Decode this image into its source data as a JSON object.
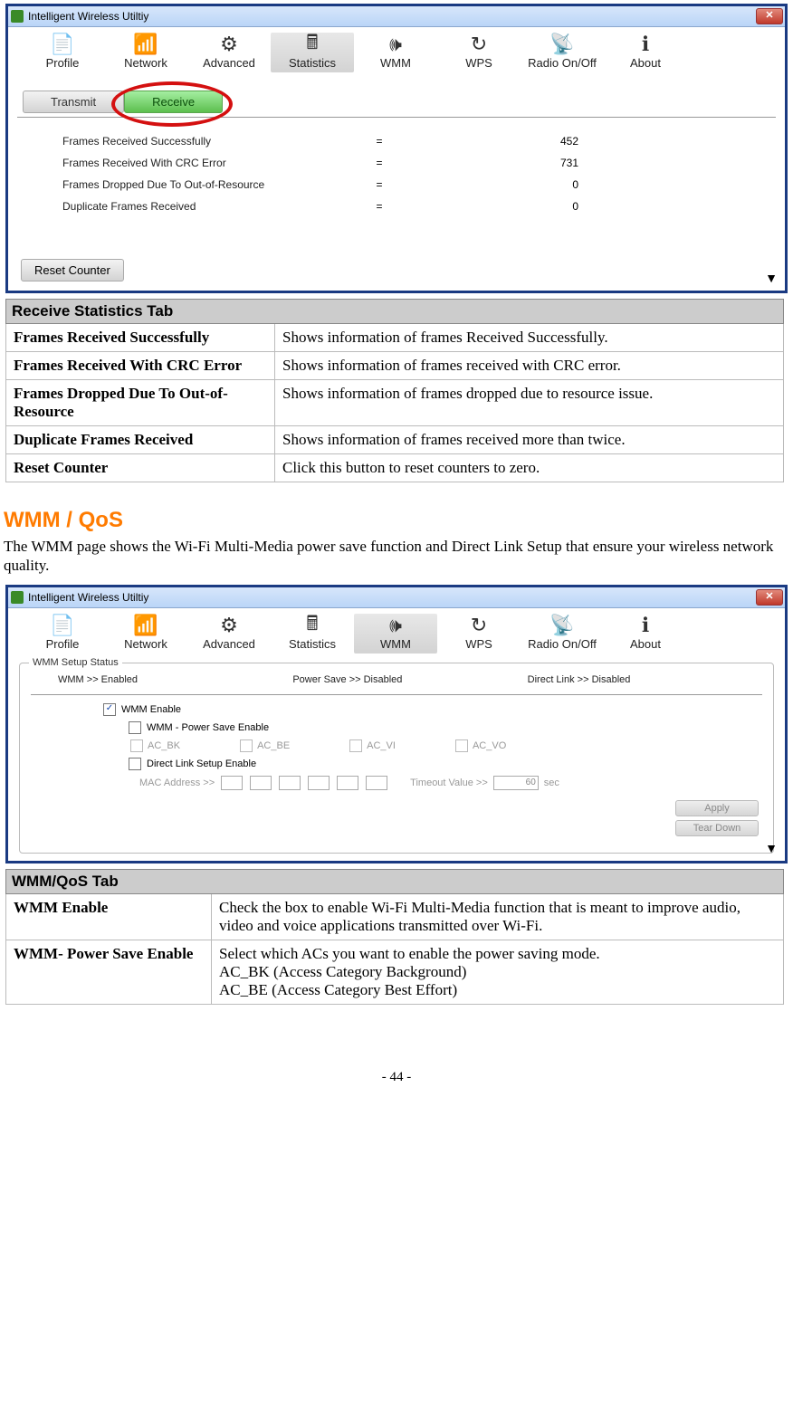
{
  "window_title": "Intelligent Wireless Utiltiy",
  "toolbar": [
    "Profile",
    "Network",
    "Advanced",
    "Statistics",
    "WMM",
    "WPS",
    "Radio On/Off",
    "About"
  ],
  "toolbar_icons": [
    "profile-icon",
    "network-icon",
    "advanced-icon",
    "statistics-icon",
    "wmm-icon",
    "wps-icon",
    "radio-icon",
    "about-icon"
  ],
  "toolbar_glyphs": [
    "📄",
    "📶",
    "⚙",
    "🖩",
    "🕪",
    "↻",
    "📡",
    "ℹ"
  ],
  "win1": {
    "active_tool": 3,
    "tabs": {
      "transmit": "Transmit",
      "receive": "Receive",
      "active": "receive"
    },
    "stats": [
      {
        "label": "Frames Received Successfully",
        "value": "452"
      },
      {
        "label": "Frames Received With CRC Error",
        "value": "731"
      },
      {
        "label": "Frames Dropped Due To Out-of-Resource",
        "value": "0"
      },
      {
        "label": "Duplicate Frames Received",
        "value": "0"
      }
    ],
    "reset_label": "Reset Counter"
  },
  "table1": {
    "header": "Receive Statistics Tab",
    "rows": [
      {
        "term": "Frames Received Successfully",
        "def": "Shows information of frames Received Successfully."
      },
      {
        "term": "Frames Received With CRC Error",
        "def": "Shows information of frames received with CRC error."
      },
      {
        "term": "Frames Dropped Due To Out-of-Resource",
        "def": "Shows information of frames dropped due to resource issue."
      },
      {
        "term": "Duplicate Frames Received",
        "def": "Shows information of frames received more than twice."
      },
      {
        "term": "Reset Counter",
        "def": "Click this button to reset counters to zero."
      }
    ]
  },
  "section2": {
    "heading": "WMM / QoS",
    "para": "The WMM page shows the Wi-Fi Multi-Media power save function and Direct Link Setup that ensure your wireless network quality."
  },
  "win2": {
    "active_tool": 4,
    "group_title": "WMM Setup Status",
    "status": {
      "wmm": "WMM >>  Enabled",
      "ps": "Power Save >> Disabled",
      "dl": "Direct Link >> Disabled"
    },
    "cb": {
      "wmm_enable": "WMM Enable",
      "ps_enable": "WMM - Power Save Enable",
      "acs": [
        "AC_BK",
        "AC_BE",
        "AC_VI",
        "AC_VO"
      ],
      "dl_enable": "Direct Link Setup Enable",
      "mac_label": "MAC Address >>",
      "timeout_label": "Timeout Value >>",
      "timeout_value": "60",
      "timeout_unit": "sec"
    },
    "buttons": {
      "apply": "Apply",
      "tear": "Tear Down"
    }
  },
  "table2": {
    "header": "WMM/QoS Tab",
    "rows": [
      {
        "term": "WMM Enable",
        "def": "Check the box to enable Wi-Fi Multi-Media function that is meant to improve audio, video and voice applications transmitted over Wi-Fi."
      },
      {
        "term": "WMM- Power Save Enable",
        "def": "Select which ACs you want to enable the power saving mode.\nAC_BK (Access Category Background)\nAC_BE (Access Category Best Effort)"
      }
    ]
  },
  "page_footer": "- 44 -"
}
